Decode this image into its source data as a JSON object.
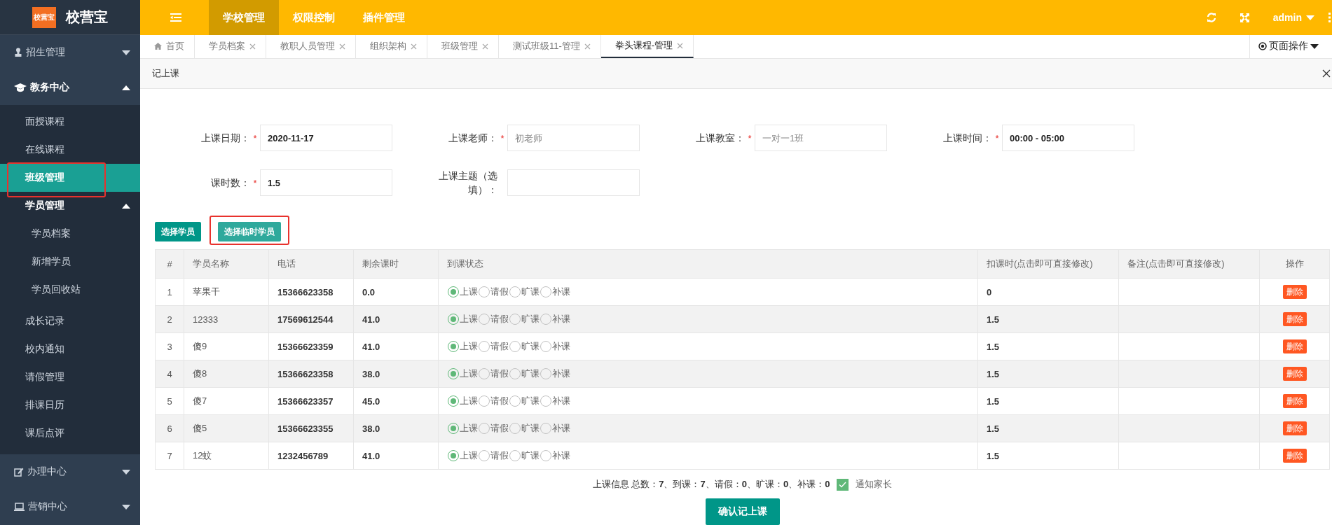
{
  "app": {
    "logo_badge": "校营宝",
    "name": "校营宝"
  },
  "top_nav": [
    {
      "label": "学校管理",
      "selected": true
    },
    {
      "label": "权限控制",
      "selected": false
    },
    {
      "label": "插件管理",
      "selected": false
    }
  ],
  "user": {
    "name": "admin"
  },
  "sidebar": [
    {
      "label": "招生管理",
      "expanded": false
    },
    {
      "label": "教务中心",
      "expanded": true,
      "children": [
        {
          "label": "面授课程",
          "selected": false
        },
        {
          "label": "在线课程",
          "selected": false
        },
        {
          "label": "班级管理",
          "selected": true,
          "highlighted": true
        },
        {
          "label": "学员管理",
          "selected": false,
          "expanded": true,
          "children": [
            {
              "label": "学员档案",
              "selected": false
            },
            {
              "label": "新增学员",
              "selected": false
            },
            {
              "label": "学员回收站",
              "selected": false
            }
          ]
        },
        {
          "label": "成长记录",
          "selected": false
        },
        {
          "label": "校内通知",
          "selected": false
        },
        {
          "label": "请假管理",
          "selected": false
        },
        {
          "label": "排课日历",
          "selected": false
        },
        {
          "label": "课后点评",
          "selected": false
        }
      ]
    },
    {
      "label": "办理中心",
      "expanded": false
    },
    {
      "label": "营销中心",
      "expanded": false
    }
  ],
  "tabs": [
    {
      "label": "首页",
      "closable": false,
      "selected": false
    },
    {
      "label": "学员档案",
      "closable": true,
      "selected": false
    },
    {
      "label": "教职人员管理",
      "closable": true,
      "selected": false
    },
    {
      "label": "组织架构",
      "closable": true,
      "selected": false
    },
    {
      "label": "班级管理",
      "closable": true,
      "selected": false
    },
    {
      "label": "测试班级11-管理",
      "closable": true,
      "selected": false
    },
    {
      "label": "拳头课程-管理",
      "closable": true,
      "selected": true
    }
  ],
  "page_actions": "页面操作",
  "panel": {
    "title": "记上课"
  },
  "form_rows": [
    [
      {
        "label": "上课日期：",
        "required_mark": "*",
        "value": "2020-11-17"
      },
      {
        "label": "上课老师：",
        "required_mark": "*",
        "placeholder": "初老师"
      },
      {
        "label": "上课教室：",
        "required_mark": "*",
        "placeholder": "一对一1班"
      },
      {
        "label": "上课时间：",
        "required_mark": "*",
        "value": "00:00 - 05:00"
      }
    ],
    [
      {
        "label": "课时数：",
        "required_mark": "*",
        "value": "1.5"
      },
      {
        "label": "上课主题（选填）："
      }
    ]
  ],
  "buttons": [
    {
      "label": "选择学员",
      "kind": "primary",
      "highlighted": false
    },
    {
      "label": "选择临时学员",
      "kind": "light",
      "highlighted": true
    }
  ],
  "table": {
    "columns": [
      "#",
      "学员名称",
      "电话",
      "剩余课时",
      "到课状态",
      "扣课时(点击即可直接修改)",
      "备注(点击即可直接修改)",
      "操作"
    ],
    "rows": [
      {
        "index": "1",
        "name": "苹果干",
        "phone": "15366623358",
        "remaining": "0.0",
        "status": [
          {
            "label": "上课",
            "selected": true
          },
          {
            "label": "请假",
            "selected": false
          },
          {
            "label": "旷课",
            "selected": false
          },
          {
            "label": "补课",
            "selected": false
          }
        ],
        "deduct": "0",
        "action": "删除"
      },
      {
        "index": "2",
        "name": "12333",
        "phone": "17569612544",
        "remaining": "41.0",
        "status": [
          {
            "label": "上课",
            "selected": true
          },
          {
            "label": "请假",
            "selected": false
          },
          {
            "label": "旷课",
            "selected": false
          },
          {
            "label": "补课",
            "selected": false
          }
        ],
        "deduct": "1.5",
        "action": "删除"
      },
      {
        "index": "3",
        "name": "傻9",
        "phone": "15366623359",
        "remaining": "41.0",
        "status": [
          {
            "label": "上课",
            "selected": true
          },
          {
            "label": "请假",
            "selected": false
          },
          {
            "label": "旷课",
            "selected": false
          },
          {
            "label": "补课",
            "selected": false
          }
        ],
        "deduct": "1.5",
        "action": "删除"
      },
      {
        "index": "4",
        "name": "傻8",
        "phone": "15366623358",
        "remaining": "38.0",
        "status": [
          {
            "label": "上课",
            "selected": true
          },
          {
            "label": "请假",
            "selected": false
          },
          {
            "label": "旷课",
            "selected": false
          },
          {
            "label": "补课",
            "selected": false
          }
        ],
        "deduct": "1.5",
        "action": "删除"
      },
      {
        "index": "5",
        "name": "傻7",
        "phone": "15366623357",
        "remaining": "45.0",
        "status": [
          {
            "label": "上课",
            "selected": true
          },
          {
            "label": "请假",
            "selected": false
          },
          {
            "label": "旷课",
            "selected": false
          },
          {
            "label": "补课",
            "selected": false
          }
        ],
        "deduct": "1.5",
        "action": "删除"
      },
      {
        "index": "6",
        "name": "傻5",
        "phone": "15366623355",
        "remaining": "38.0",
        "status": [
          {
            "label": "上课",
            "selected": true
          },
          {
            "label": "请假",
            "selected": false
          },
          {
            "label": "旷课",
            "selected": false
          },
          {
            "label": "补课",
            "selected": false
          }
        ],
        "deduct": "1.5",
        "action": "删除"
      },
      {
        "index": "7",
        "name": "12蚊",
        "phone": "1232456789",
        "remaining": "41.0",
        "status": [
          {
            "label": "上课",
            "selected": true
          },
          {
            "label": "请假",
            "selected": false
          },
          {
            "label": "旷课",
            "selected": false
          },
          {
            "label": "补课",
            "selected": false
          }
        ],
        "deduct": "1.5",
        "action": "删除"
      }
    ]
  },
  "summary": "上课信息 总数：**7**、到课：**7**、请假：**0**、旷课：**0**、补课：**0**",
  "notify": {
    "label": "通知家长",
    "checked": true
  },
  "confirm_button": "确认记上课"
}
